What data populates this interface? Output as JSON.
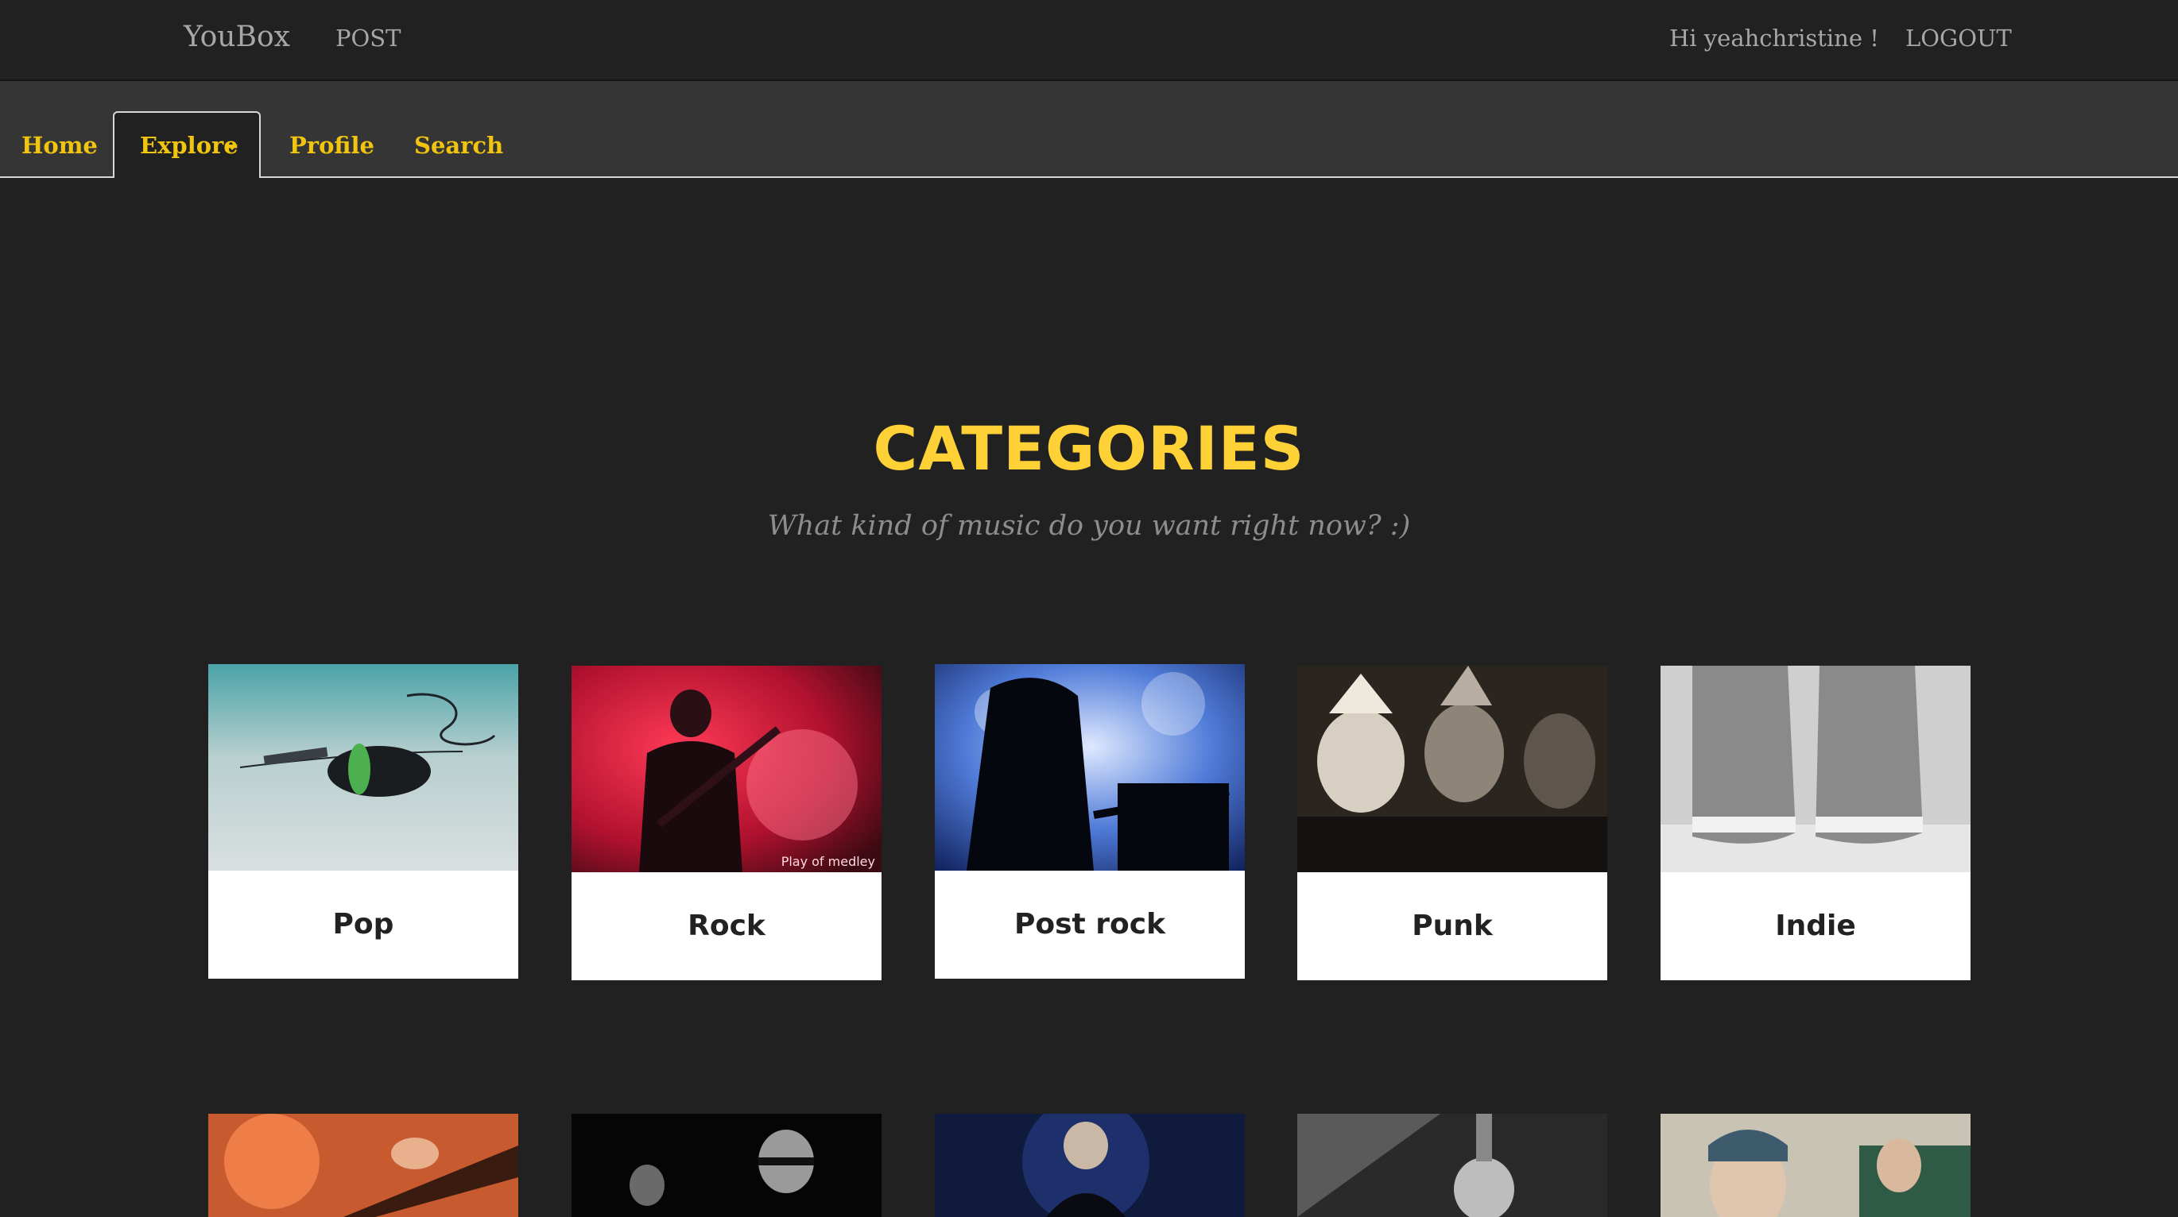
{
  "topbar": {
    "brand": "YouBox",
    "post": "POST",
    "greeting": "Hi yeahchristine !",
    "logout": "LOGOUT"
  },
  "tabs": {
    "home": "Home",
    "explore": "Explore",
    "profile": "Profile",
    "search": "Search"
  },
  "section": {
    "title": "CATEGORIES",
    "subtitle": "What kind of music do you want right now? :)"
  },
  "categories": [
    {
      "label": "Pop"
    },
    {
      "label": "Rock",
      "watermark": "Play of medley"
    },
    {
      "label": "Post rock"
    },
    {
      "label": "Punk"
    },
    {
      "label": "Indie"
    }
  ],
  "colors": {
    "accent": "#fed136",
    "tab_text": "#f1c40f",
    "background": "#212121"
  }
}
